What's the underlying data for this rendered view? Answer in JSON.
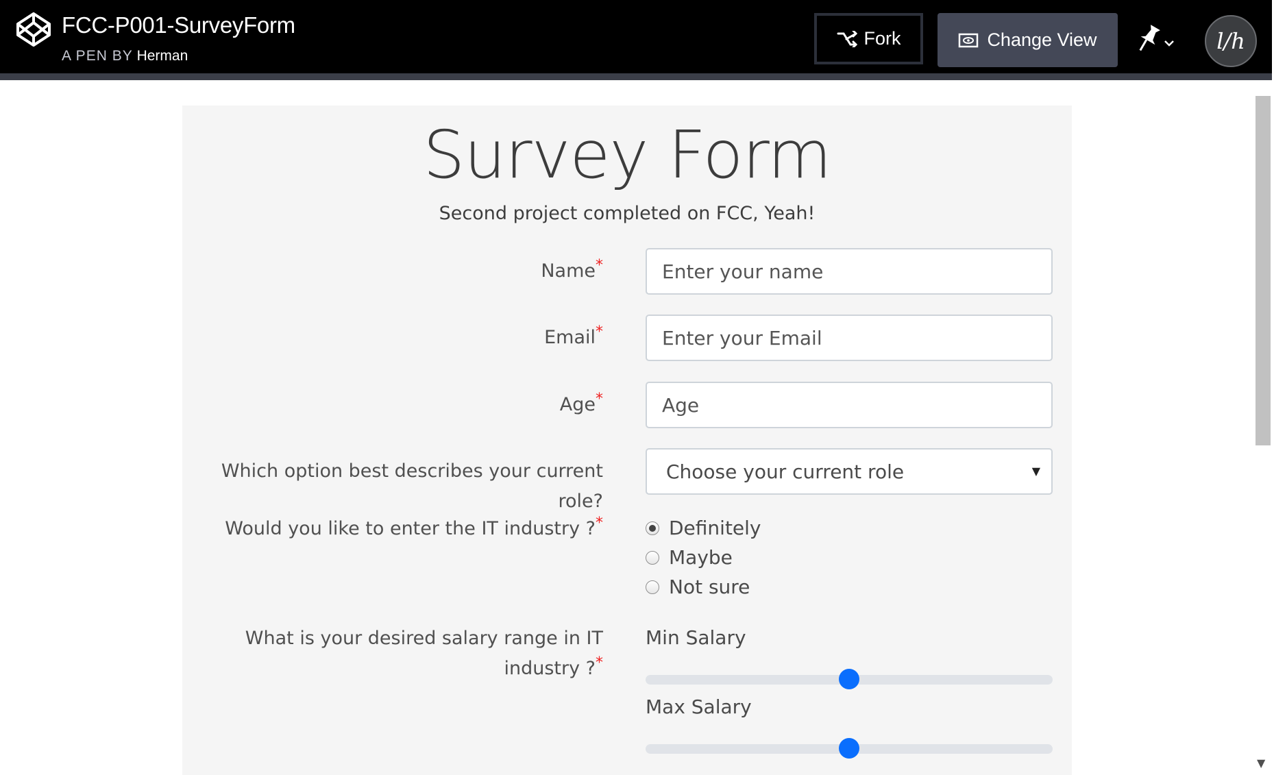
{
  "header": {
    "pen_title": "FCC-P001-SurveyForm",
    "sub_prefix": "A PEN BY",
    "author": "Herman",
    "fork_label": "Fork",
    "change_view_label": "Change View",
    "avatar_text": "l/h"
  },
  "form": {
    "title": "Survey Form",
    "description": "Second project completed on FCC, Yeah!",
    "name_label": "Name",
    "name_placeholder": "Enter your name",
    "email_label": "Email",
    "email_placeholder": "Enter your Email",
    "age_label": "Age",
    "age_placeholder": "Age",
    "role_label": "Which option best describes your current role?",
    "role_selected": "Choose your current role",
    "it_label": "Would you like to enter the IT industry ?",
    "it_options": [
      {
        "label": "Definitely",
        "checked": true
      },
      {
        "label": "Maybe",
        "checked": false
      },
      {
        "label": "Not sure",
        "checked": false
      }
    ],
    "salary_label_line1": "What is your desired salary range in IT",
    "salary_label_line2": "industry ?",
    "min_salary_label": "Min Salary",
    "min_salary_fraction": 0.5,
    "max_salary_label": "Max Salary",
    "max_salary_fraction": 0.5,
    "required_mark": "*"
  },
  "colors": {
    "accent": "#0a6efd",
    "required": "#ee2222",
    "header_bg": "#000000",
    "card_bg": "#f5f5f5"
  }
}
